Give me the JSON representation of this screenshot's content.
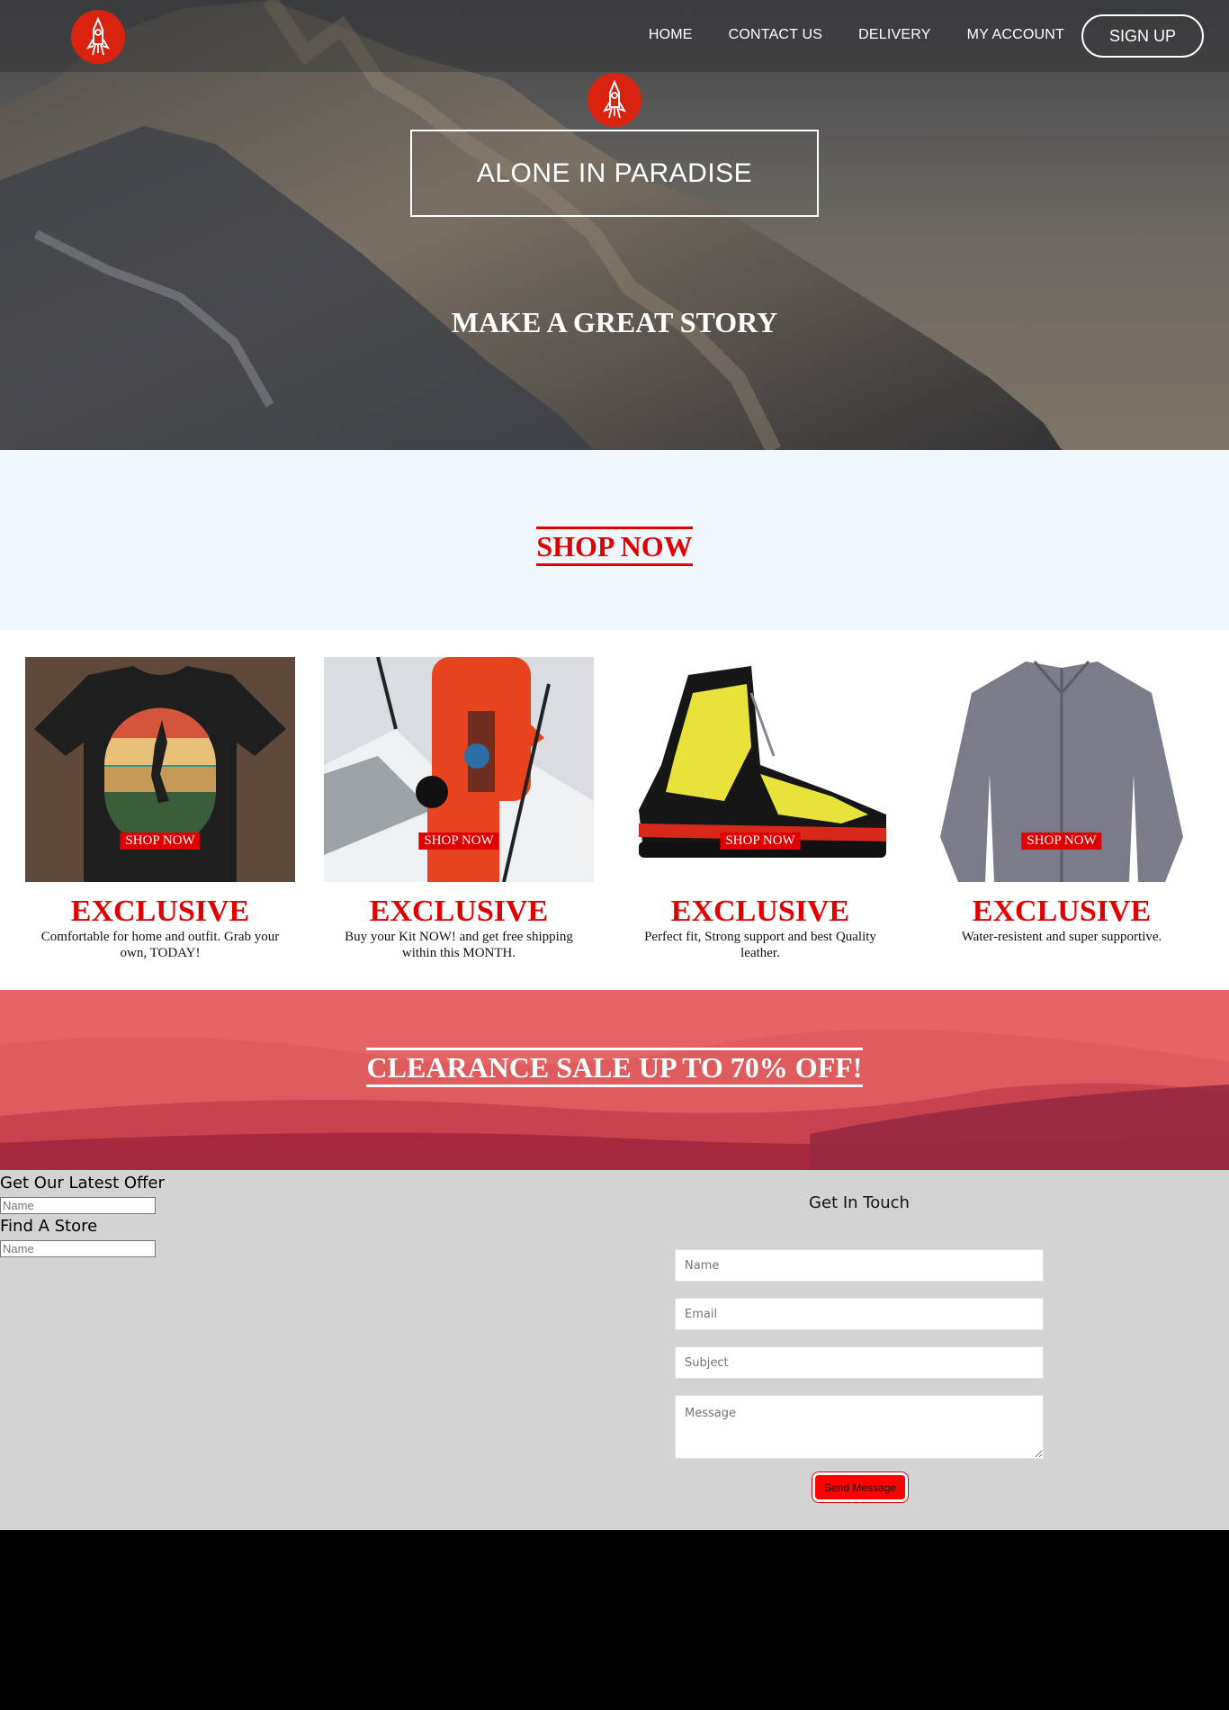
{
  "hero": {
    "nav": [
      "HOME",
      "CONTACT US",
      "DELIVERY",
      "MY ACCOUNT"
    ],
    "signup_label": "SIGN UP",
    "title": "ALONE IN PARADISE",
    "tagline": "MAKE A GREAT STORY"
  },
  "shop": {
    "title": "SHOP NOW"
  },
  "products": [
    {
      "badge": "SHOP NOW",
      "title": "EXCLUSIVE",
      "desc": "Comfortable for home and outfit. Grab your own, TODAY!",
      "image": "t-shirt"
    },
    {
      "badge": "SHOP NOW",
      "title": "EXCLUSIVE",
      "desc": "Buy your Kit NOW! and get free shipping within this MONTH.",
      "image": "climber-kit"
    },
    {
      "badge": "SHOP NOW",
      "title": "EXCLUSIVE",
      "desc": "Perfect fit, Strong support and best Quality leather.",
      "image": "hiking-boot"
    },
    {
      "badge": "SHOP NOW",
      "title": "EXCLUSIVE",
      "desc": "Water-resistent and super supportive.",
      "image": "jacket"
    }
  ],
  "clearance": {
    "title": "CLEARANCE SALE UP TO 70% OFF!"
  },
  "footer": {
    "offer_title": "Get Our Latest Offer",
    "offer_placeholder": "Name",
    "store_title": "Find A Store",
    "store_placeholder": "Name",
    "contact_title": "Get In Touch",
    "name_placeholder": "Name",
    "email_placeholder": "Email",
    "subject_placeholder": "Subject",
    "message_placeholder": "Message",
    "send_label": "Send Message"
  },
  "colors": {
    "accent_red": "#e00000",
    "logo_red": "#d9230f",
    "shop_band": "#f0f7ff",
    "clearance_band": "#e56465",
    "footer_bg": "#d3d3d3"
  }
}
